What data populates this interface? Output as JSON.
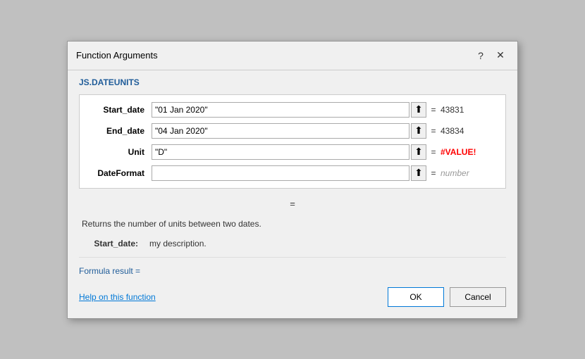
{
  "dialog": {
    "title": "Function Arguments",
    "help_icon": "?",
    "close_icon": "✕"
  },
  "function": {
    "name": "JS.DATEUNITS"
  },
  "arguments": [
    {
      "label": "Start_date",
      "value": "\"01 Jan 2020\"",
      "result": "43831",
      "result_type": "normal"
    },
    {
      "label": "End_date",
      "value": "\"04 Jan 2020\"",
      "result": "43834",
      "result_type": "normal"
    },
    {
      "label": "Unit",
      "value": "\"D\"",
      "result": "#VALUE!",
      "result_type": "error"
    },
    {
      "label": "DateFormat",
      "value": "",
      "result": "number",
      "result_type": "muted"
    }
  ],
  "formula_equals": "=",
  "description": {
    "main": "Returns the number of units between two dates.",
    "param_name": "Start_date:",
    "param_desc": "my description."
  },
  "formula_result_label": "Formula result =",
  "help_link": "Help on this function",
  "buttons": {
    "ok": "OK",
    "cancel": "Cancel"
  }
}
